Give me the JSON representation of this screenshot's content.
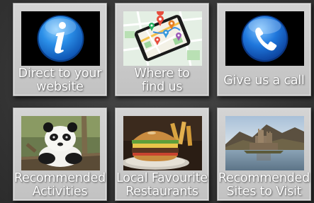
{
  "tiles": [
    {
      "id": "direct-to-website",
      "icon": "info-icon",
      "caption_lines": [
        "Direct to your",
        "website"
      ]
    },
    {
      "id": "where-to-find-us",
      "icon": "map-phone-icon",
      "caption_lines": [
        "Where to",
        "find us"
      ]
    },
    {
      "id": "give-us-a-call",
      "icon": "phone-icon",
      "caption_lines": [
        "Give us a call"
      ]
    },
    {
      "id": "recommended-activities",
      "icon": "panda-image",
      "caption_lines": [
        "Recommended",
        "Activities"
      ]
    },
    {
      "id": "local-favourite-restaurants",
      "icon": "burger-image",
      "caption_lines": [
        "Local Favourite",
        "Restaurants"
      ]
    },
    {
      "id": "recommended-sites",
      "icon": "castle-image",
      "caption_lines": [
        "Recommended",
        "Sites to Visit"
      ]
    }
  ],
  "colors": {
    "info_blue": "#1f7fe0",
    "phone_blue": "#1a6fd6",
    "tile_bg": "#c8c8c8",
    "page_bg": "#3a3a3a"
  }
}
